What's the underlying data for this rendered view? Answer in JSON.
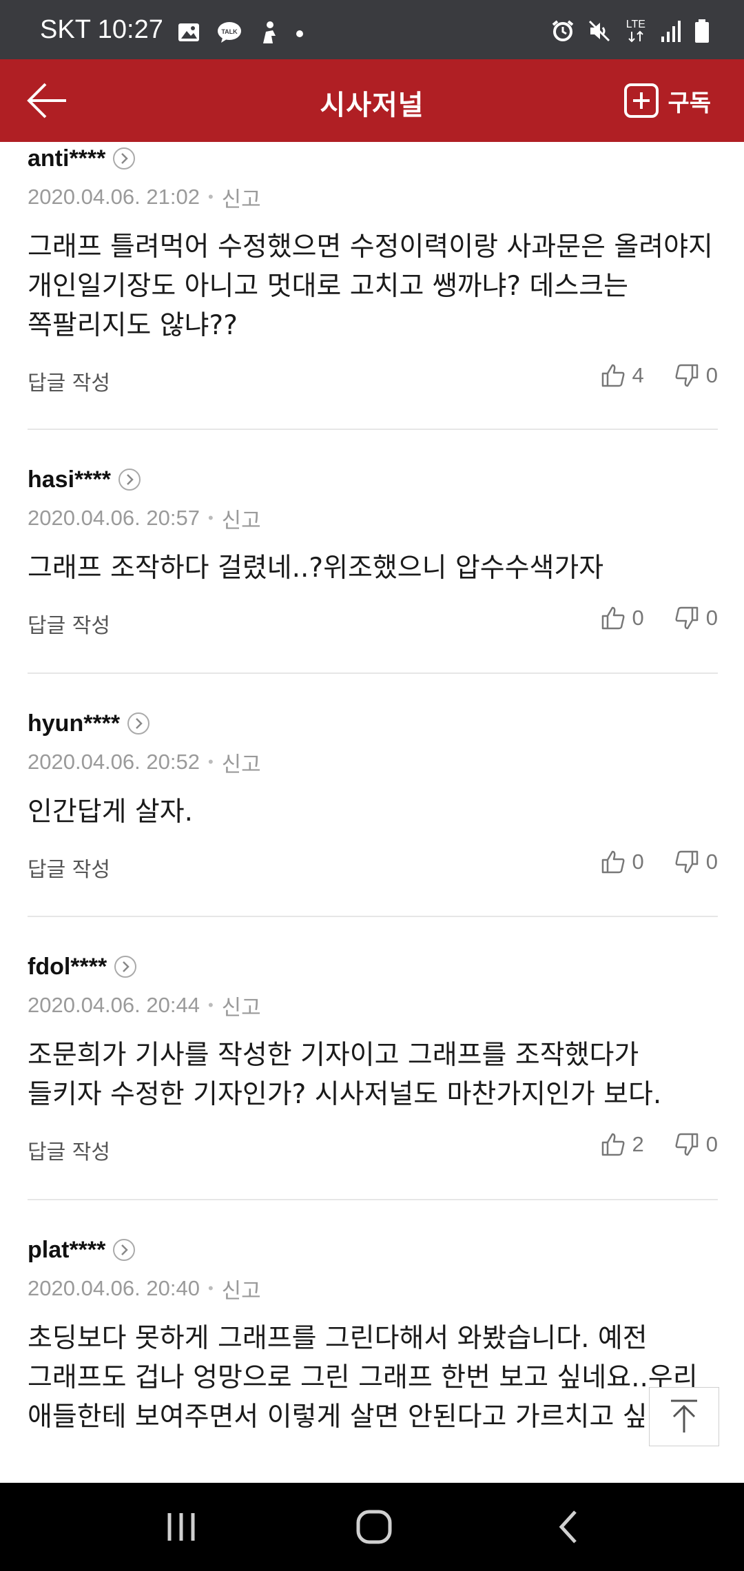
{
  "status_bar": {
    "carrier_time": "SKT 10:27",
    "lte": "LTE",
    "icons": [
      "gallery-icon",
      "talk-icon",
      "person-icon",
      "dot-icon",
      "alarm-icon",
      "mute-icon",
      "signal-icon",
      "battery-icon"
    ]
  },
  "header": {
    "title": "시사저널",
    "subscribe_label": "구독",
    "accent_color": "#b01f24"
  },
  "comments": [
    {
      "author": "anti****",
      "date": "2020.04.06. 21:02",
      "report": "신고",
      "text": "그래프 틀려먹어 수정했으면 수정이력이랑 사과문은 올려야지 개인일기장도 아니고 멋대로 고치고 쌩까냐? 데스크는 쪽팔리지도 않냐??",
      "reply_label": "답글 작성",
      "likes": "4",
      "dislikes": "0"
    },
    {
      "author": "hasi****",
      "date": "2020.04.06. 20:57",
      "report": "신고",
      "text": "그래프 조작하다 걸렸네..?위조했으니 압수수색가자",
      "reply_label": "답글 작성",
      "likes": "0",
      "dislikes": "0"
    },
    {
      "author": "hyun****",
      "date": "2020.04.06. 20:52",
      "report": "신고",
      "text": "인간답게 살자.",
      "reply_label": "답글 작성",
      "likes": "0",
      "dislikes": "0"
    },
    {
      "author": "fdol****",
      "date": "2020.04.06. 20:44",
      "report": "신고",
      "text": "조문희가 기사를 작성한 기자이고 그래프를 조작했다가 들키자 수정한 기자인가? 시사저널도 마찬가지인가 보다.",
      "reply_label": "답글 작성",
      "likes": "2",
      "dislikes": "0"
    },
    {
      "author": "plat****",
      "date": "2020.04.06. 20:40",
      "report": "신고",
      "text": "초딩보다 못하게 그래프를 그린다해서 와봤습니다. 예전 그래프도 겁나 엉망으로 그린 그래프 한번 보고 싶네요..우리 애들한테 보여주면서 이렇게 살면 안된다고 가르치고 싶네요."
    }
  ]
}
